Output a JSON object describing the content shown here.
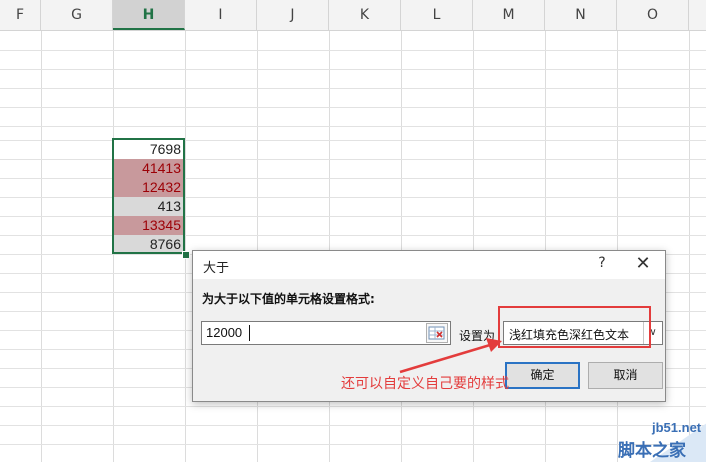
{
  "spreadsheet": {
    "columns": [
      "F",
      "G",
      "H",
      "I",
      "J",
      "K",
      "L",
      "M",
      "N",
      "O"
    ],
    "selected_column": "H",
    "cells": [
      {
        "value": "7698",
        "style": "plain"
      },
      {
        "value": "41413",
        "style": "highlight"
      },
      {
        "value": "12432",
        "style": "highlight"
      },
      {
        "value": "413",
        "style": "grey"
      },
      {
        "value": "13345",
        "style": "highlight"
      },
      {
        "value": "8766",
        "style": "grey"
      }
    ],
    "highlight_fill": "#c8999c",
    "highlight_text": "#9c0006",
    "accent": "#217346"
  },
  "dialog": {
    "title": "大于",
    "help": "?",
    "close": "✕",
    "prompt": "为大于以下值的单元格设置格式:",
    "value": "12000",
    "set_label": "设置为",
    "format_option": "浅红填充色深红色文本",
    "ok_label": "确定",
    "cancel_label": "取消"
  },
  "annotation": {
    "text": "还可以自定义自己要的样式",
    "color": "#e33c3c"
  },
  "watermark": {
    "url": "jb51.net",
    "brand": "脚本之家"
  }
}
